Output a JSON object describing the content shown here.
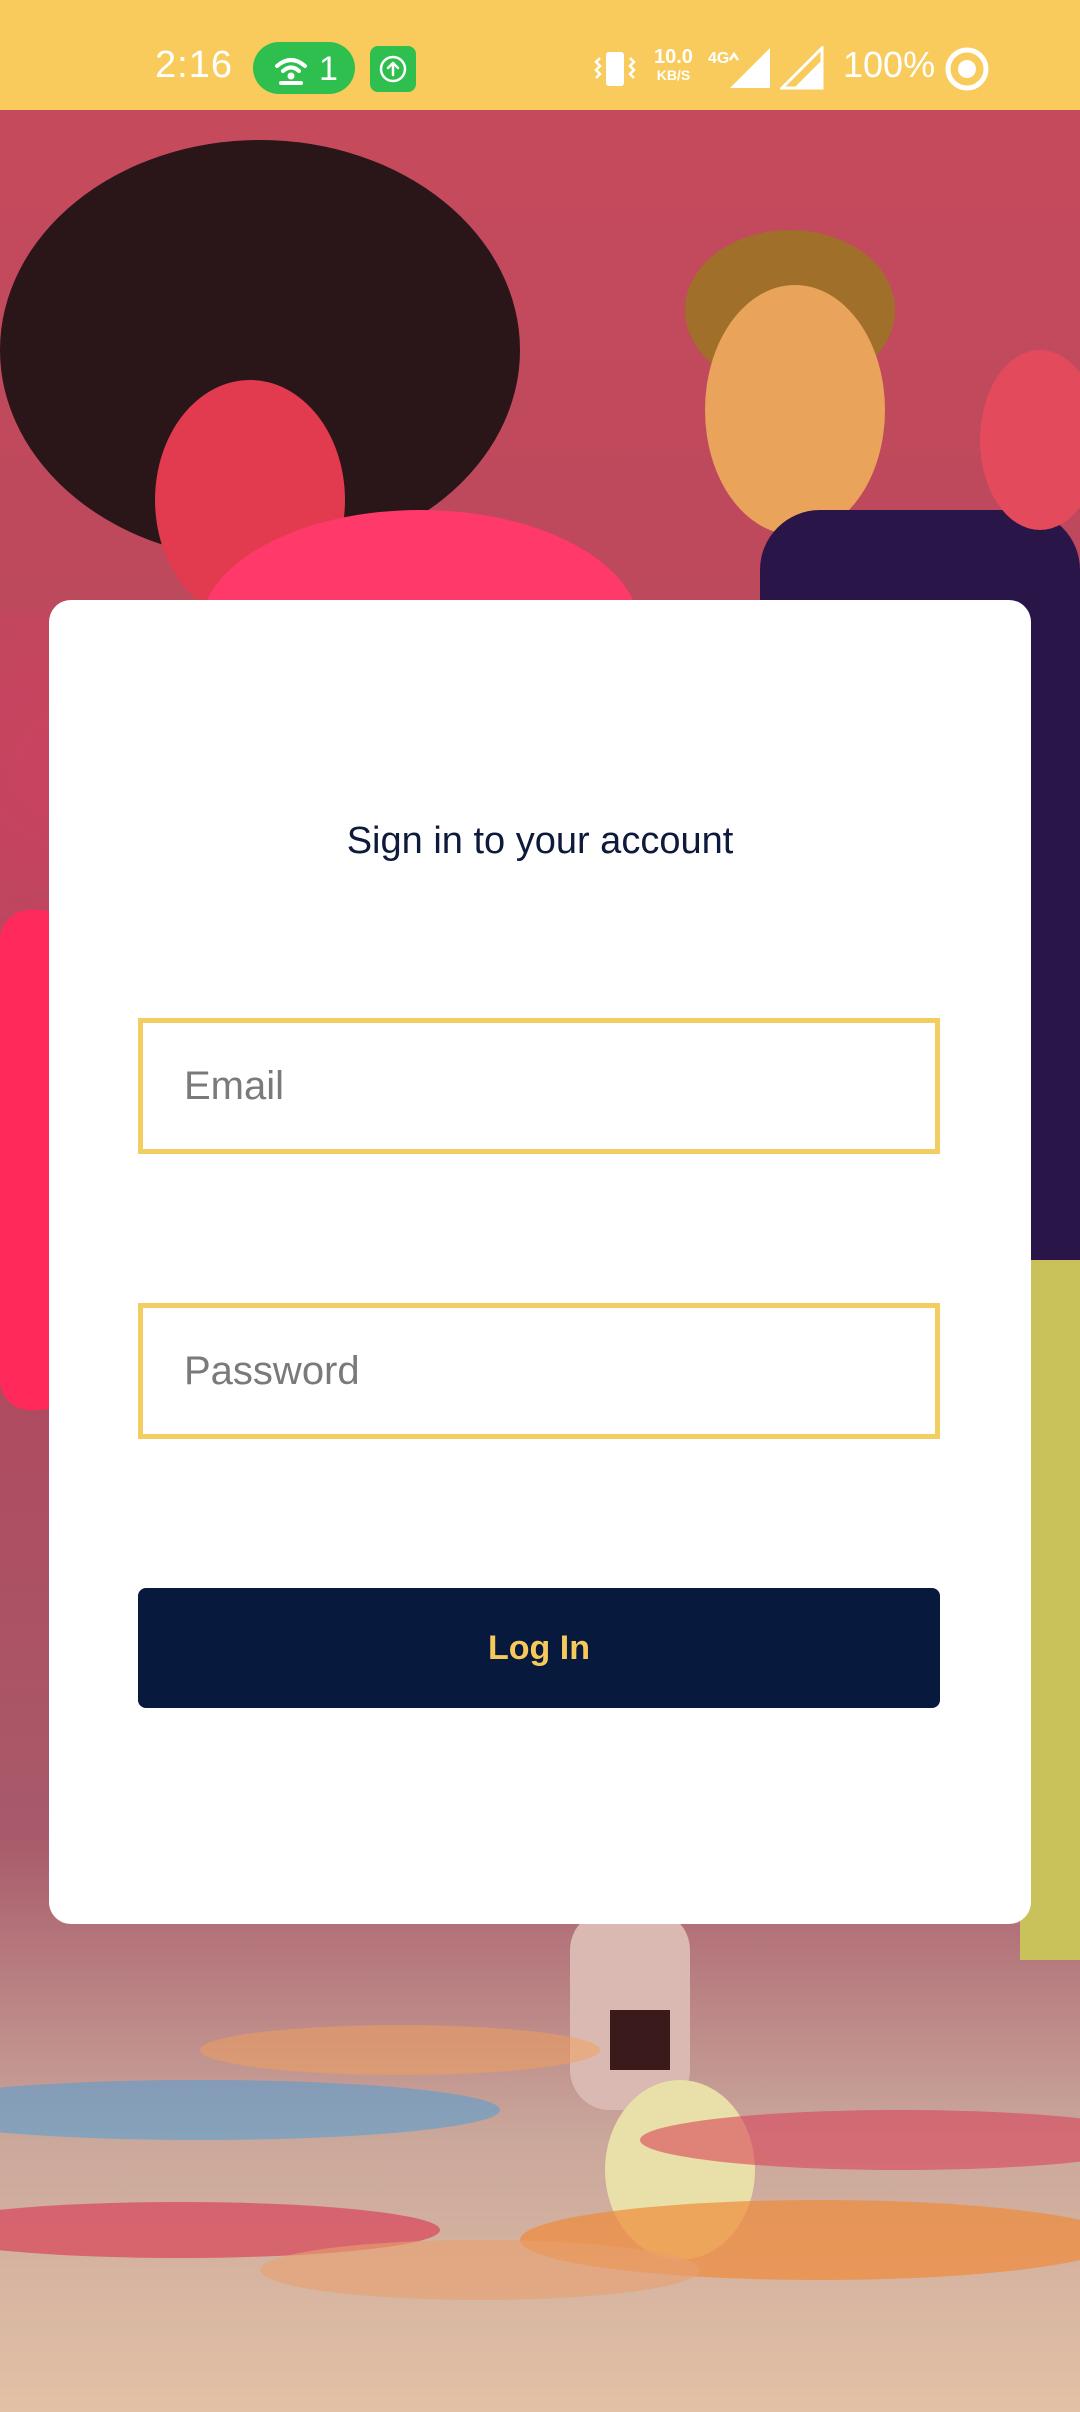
{
  "status_bar": {
    "time": "2:16",
    "notification_count": "1",
    "network_speed_value": "10.0",
    "network_speed_unit": "KB/S",
    "network_type": "4G",
    "battery": "100%",
    "icons": [
      "hotspot-icon",
      "upload-icon",
      "vibrate-icon",
      "data-arrows-icon",
      "signal-icon",
      "signal-icon",
      "ring-icon"
    ]
  },
  "login": {
    "title": "Sign in to your account",
    "email_placeholder": "Email",
    "email_value": "",
    "password_placeholder": "Password",
    "password_value": "",
    "submit_label": "Log In"
  },
  "colors": {
    "status_bar_bg": "#f8cb5c",
    "field_border": "#f2cd62",
    "button_bg": "#071a3e",
    "button_text": "#f6c95a",
    "title_text": "#0e1a3c"
  }
}
